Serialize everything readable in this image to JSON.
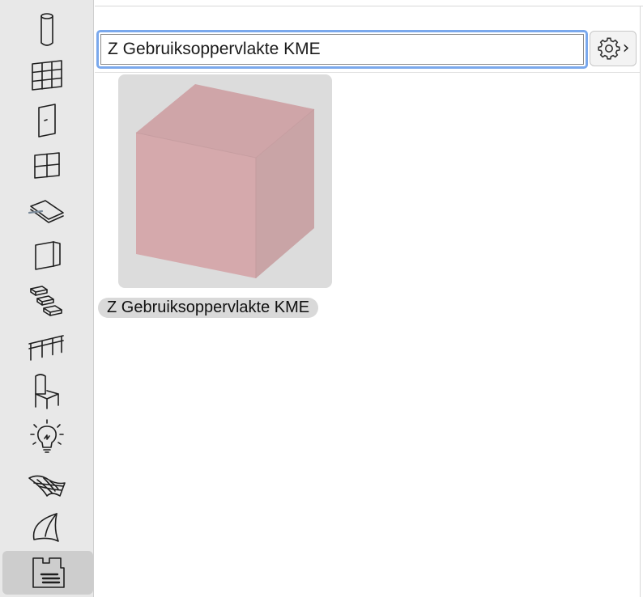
{
  "toolbox": {
    "tools": [
      {
        "name": "column-tool"
      },
      {
        "name": "curtain-wall-tool"
      },
      {
        "name": "door-tool"
      },
      {
        "name": "window-tool"
      },
      {
        "name": "slab-tool"
      },
      {
        "name": "wall-end-tool"
      },
      {
        "name": "stair-tool"
      },
      {
        "name": "railing-tool"
      },
      {
        "name": "object-tool"
      },
      {
        "name": "lamp-tool"
      },
      {
        "name": "mesh-tool"
      },
      {
        "name": "shell-tool"
      },
      {
        "name": "zone-tool",
        "active": true
      }
    ]
  },
  "search": {
    "value": "Z Gebruiksoppervlakte KME"
  },
  "settings": {
    "icon": "gear-icon",
    "chevron": "›"
  },
  "results": [
    {
      "label": "Z Gebruiksoppervlakte KME",
      "preview_color": "#d4a7aa"
    }
  ]
}
